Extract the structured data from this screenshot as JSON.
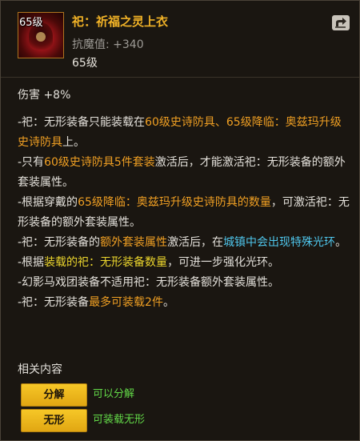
{
  "item": {
    "level_badge": "65级",
    "title": "祀：祈福之灵上衣",
    "stat_label": "抗魔值:",
    "stat_value": "+340",
    "level_text": "65级"
  },
  "icons": {
    "item_icon": "red-hooded-spirit-robe-icon",
    "share_icon": "share-arrow-icon"
  },
  "description": {
    "damage": "伤害 +8%",
    "lines": [
      [
        {
          "t": "-祀：无形装备只能装载在",
          "c": "n"
        },
        {
          "t": "60级史诗防具、65级降临：奥兹玛升级史诗防具",
          "c": "o"
        },
        {
          "t": "上。",
          "c": "n"
        }
      ],
      [
        {
          "t": "-只有",
          "c": "n"
        },
        {
          "t": "60级史诗防具5件套装",
          "c": "o"
        },
        {
          "t": "激活后，才能激活祀：无形装备的额外套装属性。",
          "c": "n"
        }
      ],
      [
        {
          "t": "-根据穿戴的",
          "c": "n"
        },
        {
          "t": "65级降临：奥兹玛升级史诗防具的数量",
          "c": "o"
        },
        {
          "t": "，可激活祀：无形装备的额外套装属性。",
          "c": "n"
        }
      ],
      [
        {
          "t": "-祀：无形装备的",
          "c": "n"
        },
        {
          "t": "额外套装属性",
          "c": "o"
        },
        {
          "t": "激活后，在",
          "c": "n"
        },
        {
          "t": "城镇中会出现特殊光环",
          "c": "c"
        },
        {
          "t": "。",
          "c": "n"
        }
      ],
      [
        {
          "t": "-根据",
          "c": "n"
        },
        {
          "t": "装载的祀：无形装备数量",
          "c": "y"
        },
        {
          "t": "，可进一步强化光环。",
          "c": "n"
        }
      ],
      [
        {
          "t": "-幻影马戏团装备不适用祀：无形装备额外套装属性。",
          "c": "n"
        }
      ],
      [
        {
          "t": "-祀：无形装备",
          "c": "n"
        },
        {
          "t": "最多可装载2件",
          "c": "o"
        },
        {
          "t": "。",
          "c": "n"
        }
      ]
    ]
  },
  "related": {
    "title": "相关内容",
    "items": [
      {
        "button": "分解",
        "desc": "可以分解"
      },
      {
        "button": "无形",
        "desc": "可装载无形"
      }
    ]
  },
  "colors": {
    "title_gold": "#f2b327",
    "highlight_orange": "#ef9f23",
    "highlight_yellow": "#ecd62d",
    "highlight_cyan": "#4fc6ec",
    "desc_green": "#63da48"
  }
}
